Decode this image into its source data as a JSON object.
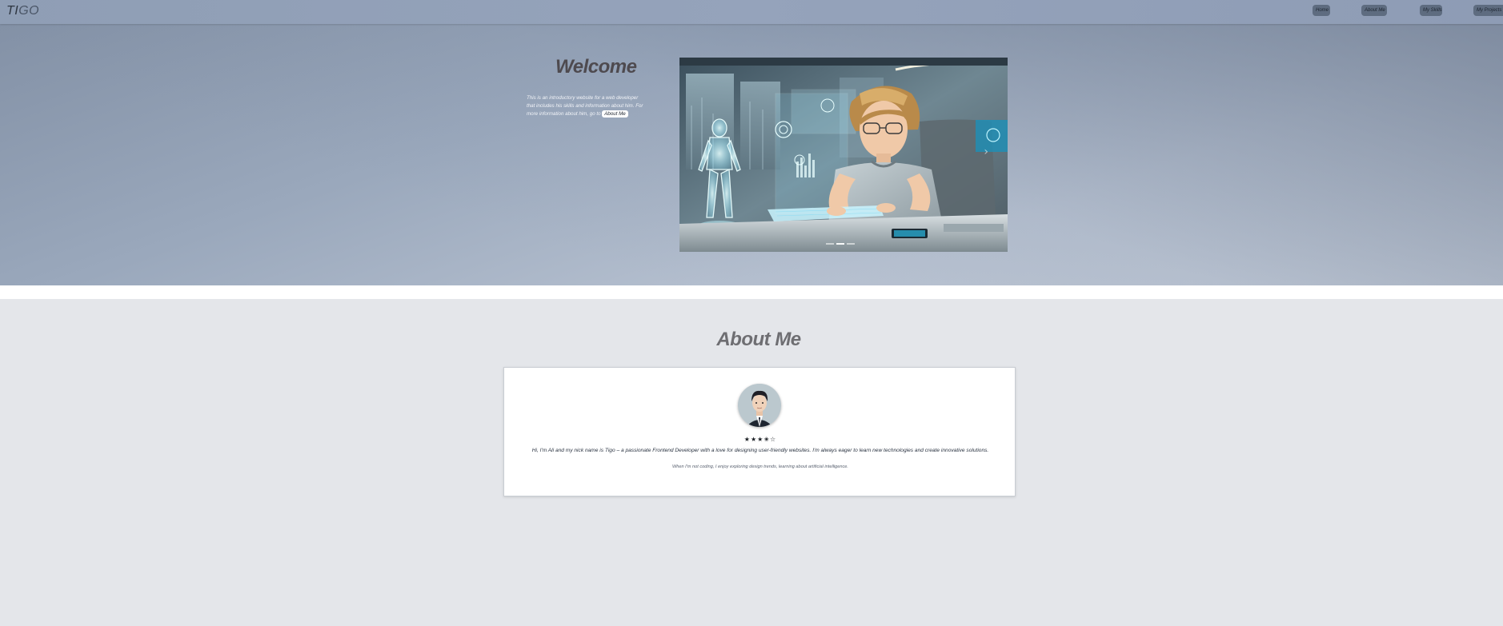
{
  "header": {
    "logo_strong": "TI",
    "logo_rest": "GO",
    "nav": [
      {
        "label": "Home"
      },
      {
        "label": "About Me"
      },
      {
        "label": "My Skills"
      },
      {
        "label": "My Projects"
      }
    ]
  },
  "hero": {
    "title": "Welcome",
    "intro_text": "This is an introductory website for a web developer that includes his skills and information about him. For more information about him, go to",
    "about_link": "About Me",
    "carousel": {
      "slide_count": 3,
      "active_slide": 2,
      "next_icon": "chevron-right-icon"
    }
  },
  "about": {
    "title": "About Me",
    "rating": {
      "value": 3.5,
      "max": 5,
      "text": "★★★✬☆"
    },
    "bio": "Hi, I'm Ali and my nick name is Tigo – a passionate Frontend Developer with a love for designing user-friendly websites. I'm always eager to learn new technologies and create innovative solutions.",
    "hobby": "When I'm not coding, I enjoy exploring design trends, learning about artificial intelligence."
  },
  "colors": {
    "header_bg": "#95a3bb",
    "nav_button_bg": "#5e6c80",
    "section_bg": "#e4e6ea",
    "card_bg": "#ffffff",
    "title_text": "#6e6e72"
  }
}
